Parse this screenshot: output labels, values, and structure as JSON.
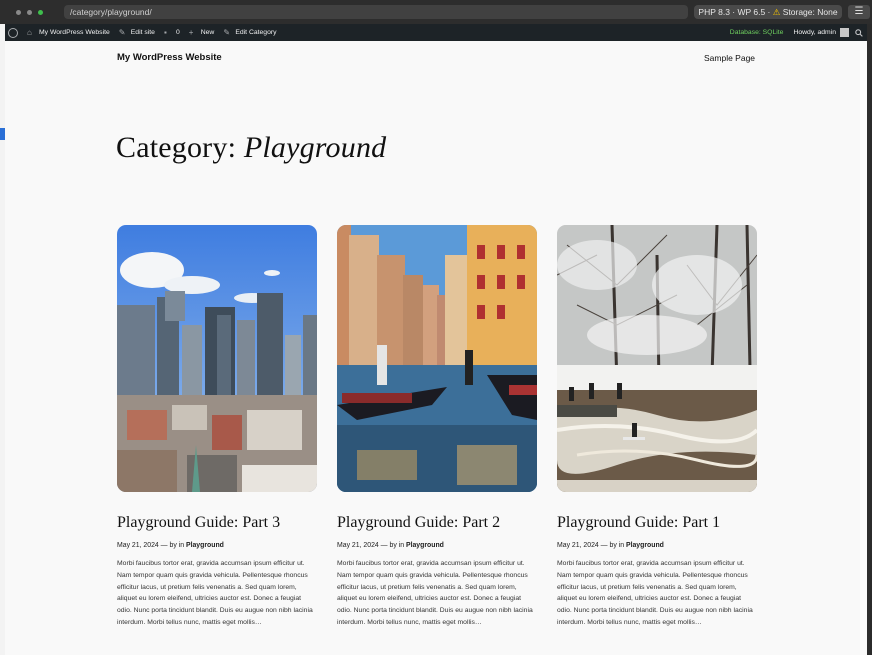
{
  "browser": {
    "url": "/category/playground/",
    "env_badge_prefix": "PHP 8.3 · WP 6.5 · ",
    "env_badge_warning": "⚠",
    "env_badge_suffix": " Storage: None",
    "menu_icon": "☰"
  },
  "adminbar": {
    "site_name": "My WordPress Website",
    "edit_site": "Edit site",
    "comments_count": "0",
    "new_label": "New",
    "edit_category": "Edit Category",
    "database": "Database: SQLite",
    "howdy": "Howdy, admin"
  },
  "header": {
    "site_title": "My WordPress Website",
    "nav": [
      "Sample Page"
    ]
  },
  "archive": {
    "prefix": "Category: ",
    "name": "Playground"
  },
  "posts": [
    {
      "title": "Playground Guide: Part 3",
      "date": "May 21, 2024",
      "by": " — by in ",
      "category": "Playground",
      "image": "city-skyline-photo",
      "excerpt": "Morbi faucibus tortor erat, gravida accumsan ipsum efficitur ut. Nam tempor quam quis gravida vehicula. Pellentesque rhoncus efficitur lacus, ut pretium felis venenatis a. Sed quam lorem, aliquet eu lorem eleifend, ultricies auctor est. Donec a feugiat odio. Nunc porta tincidunt blandit. Duis eu augue non nibh lacinia interdum. Morbi tellus nunc, mattis eget mollis…"
    },
    {
      "title": "Playground Guide: Part 2",
      "date": "May 21, 2024",
      "by": " — by in ",
      "category": "Playground",
      "image": "venice-canal-photo",
      "excerpt": "Morbi faucibus tortor erat, gravida accumsan ipsum efficitur ut. Nam tempor quam quis gravida vehicula. Pellentesque rhoncus efficitur lacus, ut pretium felis venenatis a. Sed quam lorem, aliquet eu lorem eleifend, ultricies auctor est. Donec a feugiat odio. Nunc porta tincidunt blandit. Duis eu augue non nibh lacinia interdum. Morbi tellus nunc, mattis eget mollis…"
    },
    {
      "title": "Playground Guide: Part 1",
      "date": "May 21, 2024",
      "by": " — by in ",
      "category": "Playground",
      "image": "winter-river-surfer-photo",
      "excerpt": "Morbi faucibus tortor erat, gravida accumsan ipsum efficitur ut. Nam tempor quam quis gravida vehicula. Pellentesque rhoncus efficitur lacus, ut pretium felis venenatis a. Sed quam lorem, aliquet eu lorem eleifend, ultricies auctor est. Donec a feugiat odio. Nunc porta tincidunt blandit. Duis eu augue non nibh lacinia interdum. Morbi tellus nunc, mattis eget mollis…"
    }
  ],
  "colors": {
    "adminbar_bg": "#1d2327",
    "page_bg": "#f9f9f9",
    "db_green": "#6fcf5f"
  }
}
